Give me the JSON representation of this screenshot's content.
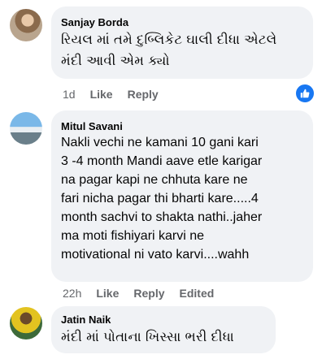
{
  "comments": [
    {
      "author": "Sanjay Borda",
      "text": "રિયલ માં તમે દુબ્લિકેટ ઘાલી દીધા એટલે\nમંદી આવી એમ ક્યો",
      "time": "1d",
      "like_label": "Like",
      "reply_label": "Reply"
    },
    {
      "author": "Mitul Savani",
      "text": "Nakli vechi ne kamani 10 gani kari\n3 -4 month Mandi aave etle karigar\nna pagar kapi ne chhuta kare ne\nfari nicha pagar thi bharti kare.....4\nmonth sachvi to shakta nathi..jaher\nma moti fishiyari karvi ne\nmotivational ni vato karvi....wahh",
      "time": "22h",
      "like_label": "Like",
      "reply_label": "Reply",
      "edited_label": "Edited"
    },
    {
      "author": "Jatin Naik",
      "text": "મંદી માં પોતાના ખિસ્સા ભરી દીધા"
    }
  ],
  "reaction": {
    "icon": "thumbs-up-icon",
    "color": "#1877f2"
  }
}
